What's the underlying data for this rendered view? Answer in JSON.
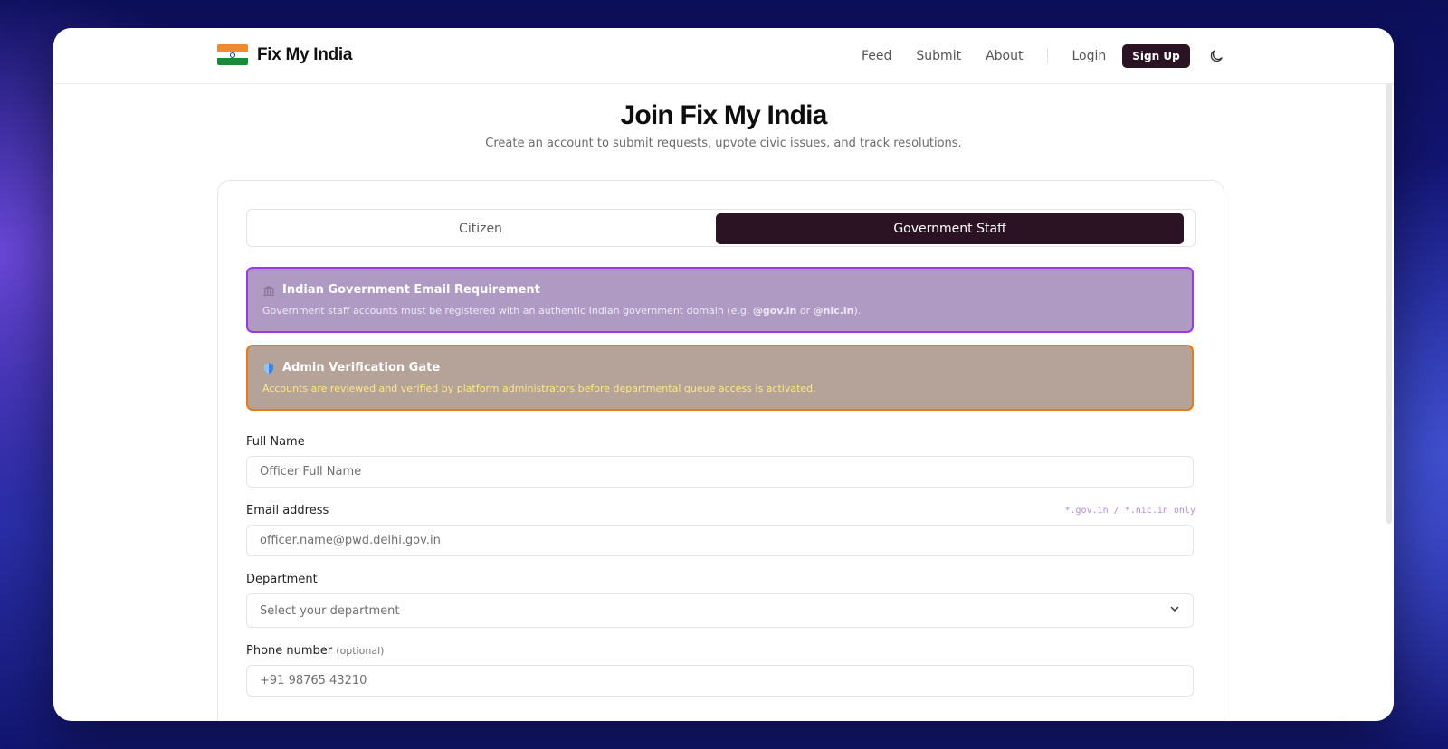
{
  "brand": {
    "name": "Fix My India"
  },
  "nav": {
    "links": [
      "Feed",
      "Submit",
      "About"
    ],
    "login": "Login",
    "signup": "Sign Up"
  },
  "page": {
    "title": "Join Fix My India",
    "subtitle": "Create an account to submit requests, upvote civic issues, and track resolutions."
  },
  "role_toggle": {
    "options": [
      "Citizen",
      "Government Staff"
    ],
    "selected": "Government Staff"
  },
  "alerts": {
    "email": {
      "title": "Indian Government Email Requirement",
      "body_prefix": "Government staff accounts must be registered with an authentic Indian government domain (e.g. ",
      "domain1": "@gov.in",
      "body_mid": " or ",
      "domain2": "@nic.in",
      "body_suffix": ")."
    },
    "verify": {
      "title": "Admin Verification Gate",
      "body": "Accounts are reviewed and verified by platform administrators before departmental queue access is activated."
    }
  },
  "form": {
    "full_name": {
      "label": "Full Name",
      "placeholder": "Officer Full Name"
    },
    "email": {
      "label": "Email address",
      "hint": "*.gov.in / *.nic.in only",
      "placeholder": "officer.name@pwd.delhi.gov.in"
    },
    "department": {
      "label": "Department",
      "value": "Select your department"
    },
    "phone": {
      "label": "Phone number",
      "optional": "(optional)",
      "placeholder": "+91 98765 43210"
    }
  },
  "colors": {
    "primary": "#2b1323",
    "purple_alert_bg": "#ae9ac3",
    "purple_alert_border": "#9a3be0",
    "orange_alert_bg": "#b5a39a",
    "orange_alert_border": "#e57a1f"
  },
  "icons": {
    "theme_toggle": "moon-icon",
    "email_alert": "government-building-icon",
    "verify_alert": "shield-icon",
    "select": "chevron-down-icon"
  }
}
